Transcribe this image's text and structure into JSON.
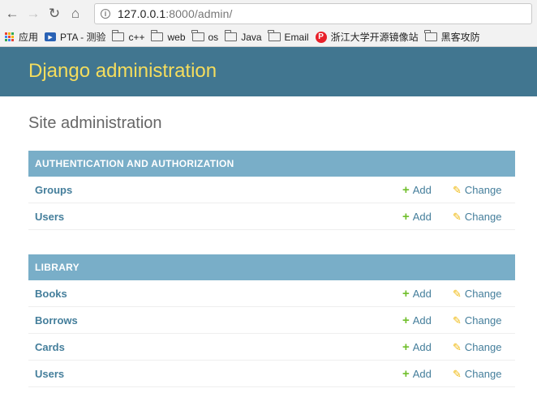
{
  "browser": {
    "url_host": "127.0.0.1",
    "url_rest": ":8000/admin/",
    "bookmarks": [
      {
        "label": "应用",
        "icon": "apps-icon"
      },
      {
        "label": "PTA - 测验",
        "icon": "pta-icon"
      },
      {
        "label": "c++",
        "icon": "folder-icon"
      },
      {
        "label": "web",
        "icon": "folder-icon"
      },
      {
        "label": "os",
        "icon": "folder-icon"
      },
      {
        "label": "Java",
        "icon": "folder-icon"
      },
      {
        "label": "Email",
        "icon": "folder-icon"
      },
      {
        "label": "浙江大学开源镜像站",
        "icon": "p-icon"
      },
      {
        "label": "黑客攻防",
        "icon": "folder-icon"
      }
    ]
  },
  "header": {
    "title": "Django administration"
  },
  "page": {
    "title": "Site administration"
  },
  "modules": [
    {
      "caption": "AUTHENTICATION AND AUTHORIZATION",
      "models": [
        {
          "name": "Groups",
          "add": "Add",
          "change": "Change"
        },
        {
          "name": "Users",
          "add": "Add",
          "change": "Change"
        }
      ]
    },
    {
      "caption": "LIBRARY",
      "models": [
        {
          "name": "Books",
          "add": "Add",
          "change": "Change"
        },
        {
          "name": "Borrows",
          "add": "Add",
          "change": "Change"
        },
        {
          "name": "Cards",
          "add": "Add",
          "change": "Change"
        },
        {
          "name": "Users",
          "add": "Add",
          "change": "Change"
        }
      ]
    }
  ],
  "colors": {
    "header_bg": "#417690",
    "title": "#f5dd5d",
    "caption_bg": "#79aec8",
    "link": "#447e9b",
    "add_icon": "#70bf2b",
    "change_icon": "#efb80b"
  }
}
